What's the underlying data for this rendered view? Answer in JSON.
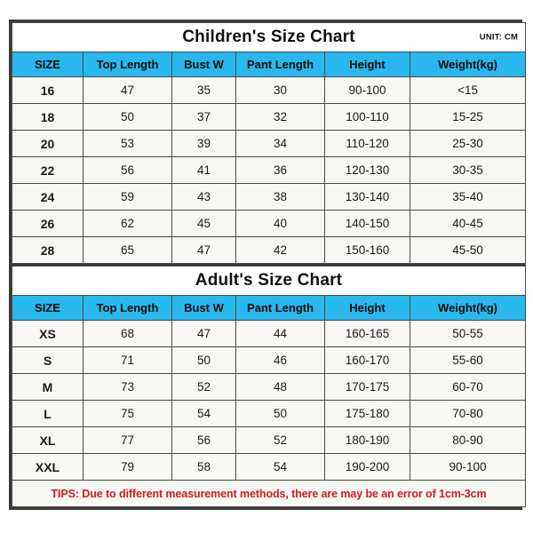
{
  "charts": [
    {
      "title": "Children's Size Chart",
      "unit_label": "UNIT: CM",
      "columns": [
        "SIZE",
        "Top Length",
        "Bust W",
        "Pant Length",
        "Height",
        "Weight(kg)"
      ],
      "rows": [
        [
          "16",
          "47",
          "35",
          "30",
          "90-100",
          "<15"
        ],
        [
          "18",
          "50",
          "37",
          "32",
          "100-110",
          "15-25"
        ],
        [
          "20",
          "53",
          "39",
          "34",
          "110-120",
          "25-30"
        ],
        [
          "22",
          "56",
          "41",
          "36",
          "120-130",
          "30-35"
        ],
        [
          "24",
          "59",
          "43",
          "38",
          "130-140",
          "35-40"
        ],
        [
          "26",
          "62",
          "45",
          "40",
          "140-150",
          "40-45"
        ],
        [
          "28",
          "65",
          "47",
          "42",
          "150-160",
          "45-50"
        ]
      ]
    },
    {
      "title": "Adult's Size Chart",
      "unit_label": "",
      "columns": [
        "SIZE",
        "Top Length",
        "Bust W",
        "Pant Length",
        "Height",
        "Weight(kg)"
      ],
      "rows": [
        [
          "XS",
          "68",
          "47",
          "44",
          "160-165",
          "50-55"
        ],
        [
          "S",
          "71",
          "50",
          "46",
          "160-170",
          "55-60"
        ],
        [
          "M",
          "73",
          "52",
          "48",
          "170-175",
          "60-70"
        ],
        [
          "L",
          "75",
          "54",
          "50",
          "175-180",
          "70-80"
        ],
        [
          "XL",
          "77",
          "56",
          "52",
          "180-190",
          "80-90"
        ],
        [
          "XXL",
          "79",
          "58",
          "54",
          "190-200",
          "90-100"
        ]
      ]
    }
  ],
  "tips": "TIPS: Due to different measurement methods, there are may be an error of 1cm-3cm",
  "colors": {
    "header_blue": "#29b8ed",
    "cell_background": "#f7f7f4",
    "border": "#4a4a4a",
    "outer_border": "#3a3a3a",
    "tips_red": "#d61a1a",
    "text": "#111111"
  },
  "chart_data": {
    "type": "table",
    "title": "Children's and Adult's Size Chart",
    "unit": "CM",
    "tables": [
      {
        "name": "Children's Size Chart",
        "columns": [
          "SIZE",
          "Top Length",
          "Bust W",
          "Pant Length",
          "Height",
          "Weight(kg)"
        ],
        "rows": [
          {
            "SIZE": "16",
            "Top Length": 47,
            "Bust W": 35,
            "Pant Length": 30,
            "Height": "90-100",
            "Weight(kg)": "<15"
          },
          {
            "SIZE": "18",
            "Top Length": 50,
            "Bust W": 37,
            "Pant Length": 32,
            "Height": "100-110",
            "Weight(kg)": "15-25"
          },
          {
            "SIZE": "20",
            "Top Length": 53,
            "Bust W": 39,
            "Pant Length": 34,
            "Height": "110-120",
            "Weight(kg)": "25-30"
          },
          {
            "SIZE": "22",
            "Top Length": 56,
            "Bust W": 41,
            "Pant Length": 36,
            "Height": "120-130",
            "Weight(kg)": "30-35"
          },
          {
            "SIZE": "24",
            "Top Length": 59,
            "Bust W": 43,
            "Pant Length": 38,
            "Height": "130-140",
            "Weight(kg)": "35-40"
          },
          {
            "SIZE": "26",
            "Top Length": 62,
            "Bust W": 45,
            "Pant Length": 40,
            "Height": "140-150",
            "Weight(kg)": "40-45"
          },
          {
            "SIZE": "28",
            "Top Length": 65,
            "Bust W": 47,
            "Pant Length": 42,
            "Height": "150-160",
            "Weight(kg)": "45-50"
          }
        ]
      },
      {
        "name": "Adult's Size Chart",
        "columns": [
          "SIZE",
          "Top Length",
          "Bust W",
          "Pant Length",
          "Height",
          "Weight(kg)"
        ],
        "rows": [
          {
            "SIZE": "XS",
            "Top Length": 68,
            "Bust W": 47,
            "Pant Length": 44,
            "Height": "160-165",
            "Weight(kg)": "50-55"
          },
          {
            "SIZE": "S",
            "Top Length": 71,
            "Bust W": 50,
            "Pant Length": 46,
            "Height": "160-170",
            "Weight(kg)": "55-60"
          },
          {
            "SIZE": "M",
            "Top Length": 73,
            "Bust W": 52,
            "Pant Length": 48,
            "Height": "170-175",
            "Weight(kg)": "60-70"
          },
          {
            "SIZE": "L",
            "Top Length": 75,
            "Bust W": 54,
            "Pant Length": 50,
            "Height": "175-180",
            "Weight(kg)": "70-80"
          },
          {
            "SIZE": "XL",
            "Top Length": 77,
            "Bust W": 56,
            "Pant Length": 52,
            "Height": "180-190",
            "Weight(kg)": "80-90"
          },
          {
            "SIZE": "XXL",
            "Top Length": 79,
            "Bust W": 58,
            "Pant Length": 54,
            "Height": "190-200",
            "Weight(kg)": "90-100"
          }
        ]
      }
    ],
    "note": "TIPS: Due to different measurement methods, there are may be an error of 1cm-3cm"
  }
}
